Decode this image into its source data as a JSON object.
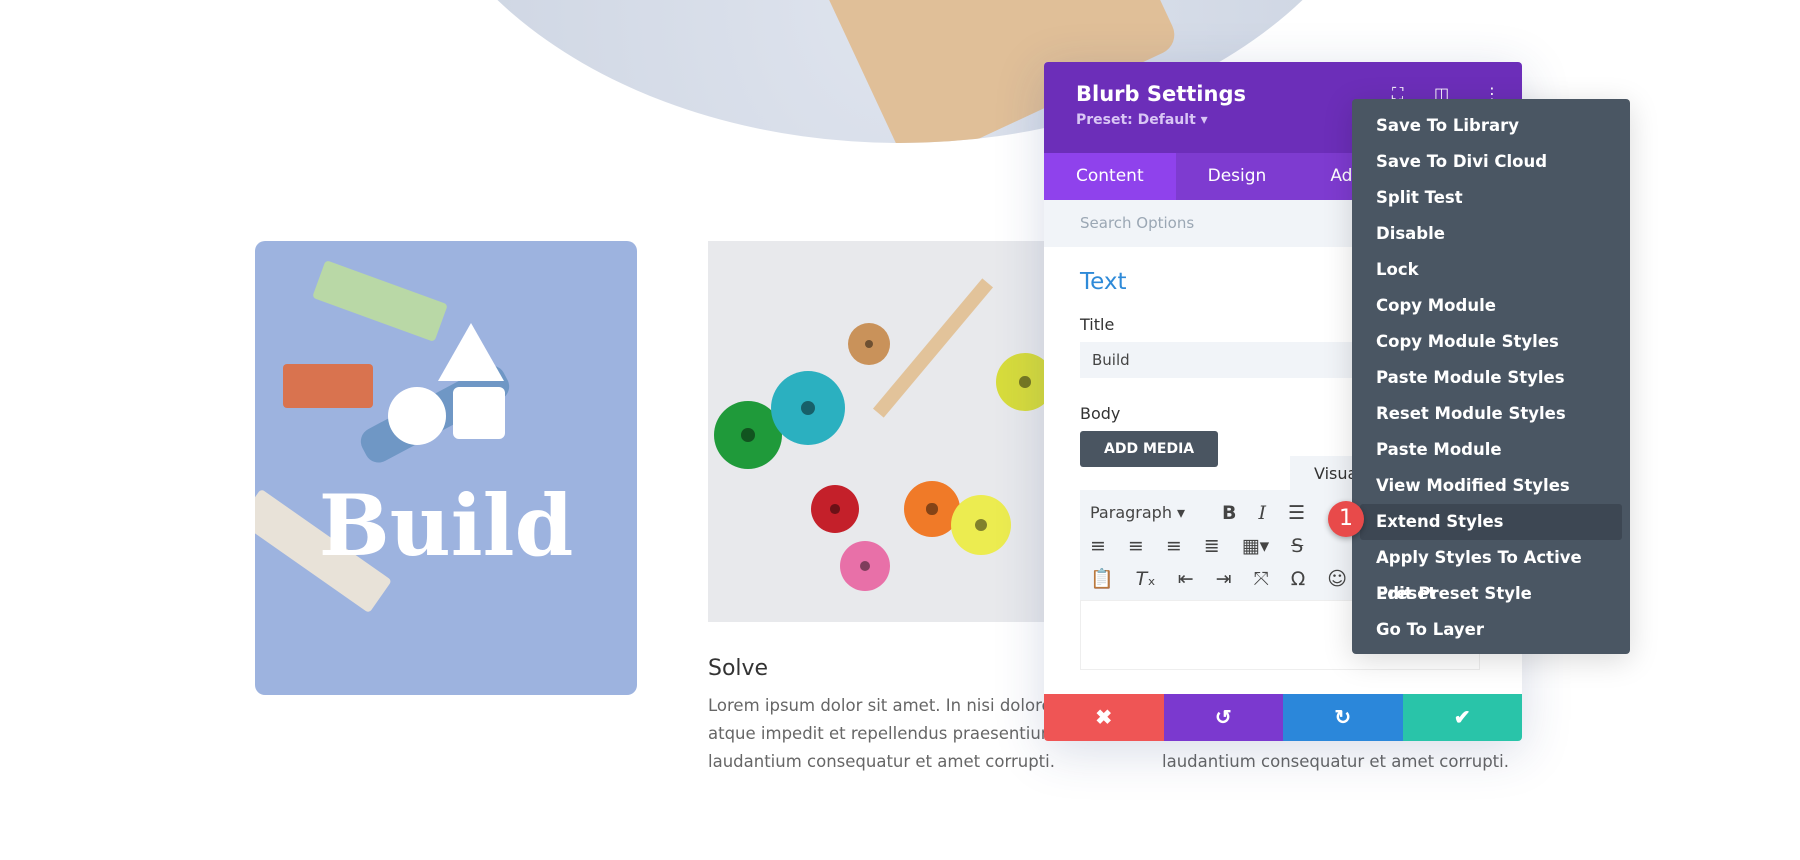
{
  "page": {
    "build_card": {
      "title": "Build"
    },
    "solve": {
      "title": "Solve",
      "body_lines": [
        "Lorem ipsum dolor sit amet. In nisi dolores",
        "atque impedit et repellendus praesentium",
        "laudantium consequatur et amet corrupti."
      ]
    },
    "third_body_line": "laudantium consequatur et amet corrupti."
  },
  "panel": {
    "title": "Blurb Settings",
    "preset": "Preset: Default ▾",
    "header_icons": [
      "focus-icon",
      "split-view-icon",
      "more-vertical-icon"
    ],
    "tabs": [
      {
        "label": "Content",
        "active": true
      },
      {
        "label": "Design"
      },
      {
        "label": "Adva"
      }
    ],
    "search_placeholder": "Search Options",
    "section_title": "Text",
    "title_label": "Title",
    "title_value": "Build",
    "body_label": "Body",
    "add_media": "ADD MEDIA",
    "visual_tab": "Visua",
    "format_select": "Paragraph",
    "footer": {
      "colors": {
        "cancel": "#ef5555",
        "undo": "#7b39cf",
        "redo": "#2b87da",
        "save": "#29c4a9"
      }
    }
  },
  "context_menu": {
    "items": [
      "Save To Library",
      "Save To Divi Cloud",
      "Split Test",
      "Disable",
      "Lock",
      "Copy Module",
      "Copy Module Styles",
      "Paste Module Styles",
      "Reset Module Styles",
      "Paste Module",
      "View Modified Styles",
      "Extend Styles",
      "Apply Styles To Active Preset",
      "Edit Preset Style",
      "Go To Layer"
    ],
    "highlighted": "Extend Styles",
    "step_badge": "1"
  },
  "colors": {
    "header": "#6c2eb9",
    "tabs": "#7e3bd0",
    "active_tab": "#8f42ec",
    "menu": "#4a5663",
    "accent": "#2e8ad8"
  }
}
